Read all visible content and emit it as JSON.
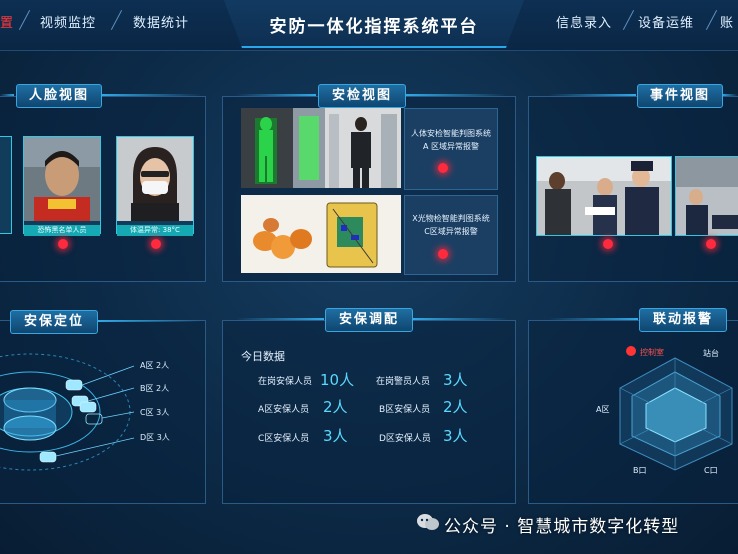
{
  "header": {
    "title": "安防一体化指挥系统平台",
    "left_nav": [
      {
        "label": "置",
        "active": true
      },
      {
        "label": "视频监控"
      },
      {
        "label": "数据统计"
      }
    ],
    "right_nav": [
      {
        "label": "信息录入"
      },
      {
        "label": "设备运维"
      },
      {
        "label": "账"
      }
    ]
  },
  "face_panel": {
    "title": "人脸视图",
    "cards": [
      {
        "caption": "恐怖黑名单人员"
      },
      {
        "caption": "体温异常: 38°C"
      }
    ]
  },
  "security_check_panel": {
    "title": "安检视图",
    "rows": [
      {
        "line1": "人体安检智能判图系统",
        "line2": "A 区域异常报警"
      },
      {
        "line1": "X光物检智能判图系统",
        "line2": "C区域异常报警"
      }
    ]
  },
  "event_panel": {
    "title": "事件视图"
  },
  "positioning_panel": {
    "title": "安保定位",
    "zones": [
      "A区 2人",
      "B区 2人",
      "C区 3人",
      "D区 3人"
    ]
  },
  "dispatch_panel": {
    "title": "安保调配",
    "subtitle": "今日数据",
    "stats": [
      {
        "label": "在岗安保人员",
        "value": "10人"
      },
      {
        "label": "在岗警员人员",
        "value": "3人"
      },
      {
        "label": "A区安保人员",
        "value": "2人"
      },
      {
        "label": "B区安保人员",
        "value": "2人"
      },
      {
        "label": "C区安保人员",
        "value": "3人"
      },
      {
        "label": "D区安保人员",
        "value": "3人"
      }
    ]
  },
  "alarm_panel": {
    "title": "联动报警",
    "legend": "控制室",
    "labels": {
      "top": "站台",
      "left": "A区",
      "bottom_left": "B口",
      "bottom_right": "C口"
    }
  },
  "watermark": "公众号 · 智慧城市数字化转型",
  "colors": {
    "accent": "#31aae8",
    "alarm": "#ff2a3d",
    "value": "#5ad8ff"
  }
}
